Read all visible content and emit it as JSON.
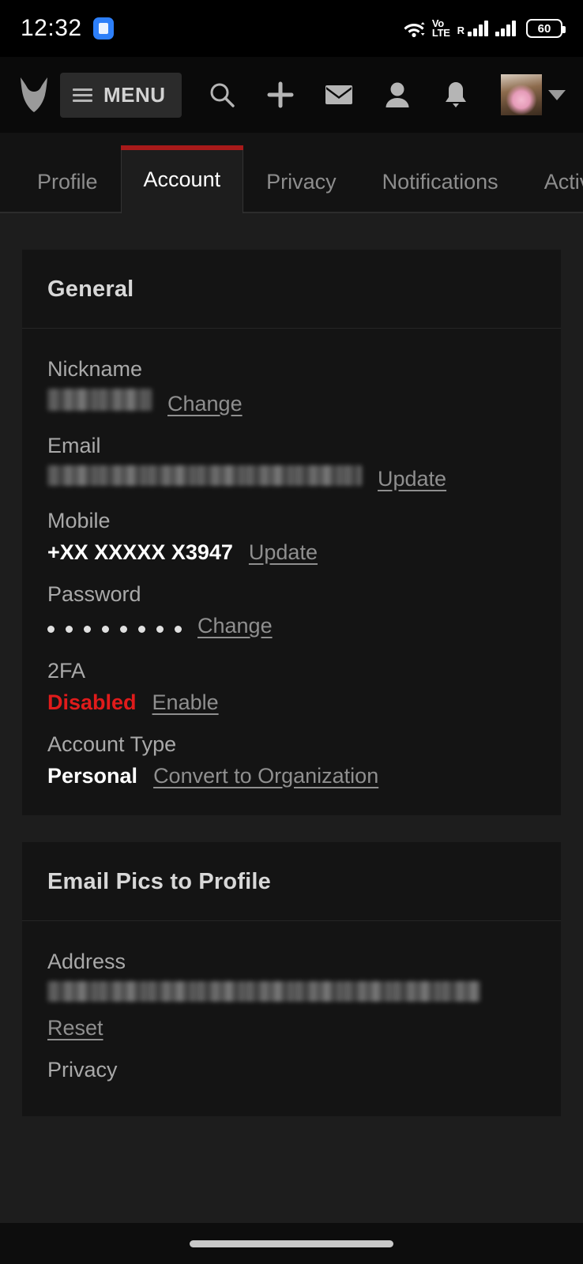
{
  "status_bar": {
    "time": "12:32",
    "chat_icon": "chat-bubble-icon",
    "wifi_icon": "wifi-icon",
    "network_label": "VoLTE",
    "network_label_line1": "Vo",
    "network_label_line2": "LTE",
    "roaming_label": "R",
    "battery_level": "60",
    "battery_icon": "battery-icon"
  },
  "app_bar": {
    "logo_icon": "furaffinity-logo-icon",
    "menu_label": "MENU",
    "menu_icon": "hamburger-icon",
    "icons": [
      {
        "name": "search-icon"
      },
      {
        "name": "plus-icon"
      },
      {
        "name": "mail-icon"
      },
      {
        "name": "person-icon"
      },
      {
        "name": "bell-icon"
      }
    ],
    "avatar_name": "avatar",
    "chevron_icon": "chevron-down-icon"
  },
  "tabs": [
    {
      "label": "Profile",
      "active": false
    },
    {
      "label": "Account",
      "active": true
    },
    {
      "label": "Privacy",
      "active": false
    },
    {
      "label": "Notifications",
      "active": false
    },
    {
      "label": "Activi",
      "active": false
    }
  ],
  "accent_colors": {
    "active_tab_indicator": "#a81a1a",
    "danger_text": "#e01b1b",
    "page_background": "#1d1d1d",
    "card_background": "#141414",
    "link_text": "#8f8f8f"
  },
  "general_card": {
    "title": "General",
    "fields": [
      {
        "label": "Nickname",
        "value": "",
        "redacted": true,
        "action": "Change"
      },
      {
        "label": "Email",
        "value": "",
        "redacted": true,
        "action": "Update"
      },
      {
        "label": "Mobile",
        "value": "+XX XXXXX X3947",
        "redacted": false,
        "action": "Update"
      },
      {
        "label": "Password",
        "value": "••••••••",
        "dots": 8,
        "redacted": false,
        "action": "Change"
      },
      {
        "label": "2FA",
        "value": "Disabled",
        "redacted": false,
        "action": "Enable"
      },
      {
        "label": "Account Type",
        "value": "Personal",
        "redacted": false,
        "action": "Convert to Organization"
      }
    ]
  },
  "email_pics_card": {
    "title": "Email Pics to Profile",
    "address_label": "Address",
    "address_value": "",
    "reset_label": "Reset",
    "privacy_label": "Privacy"
  },
  "nav_bar": {
    "pill_name": "gesture-pill"
  }
}
